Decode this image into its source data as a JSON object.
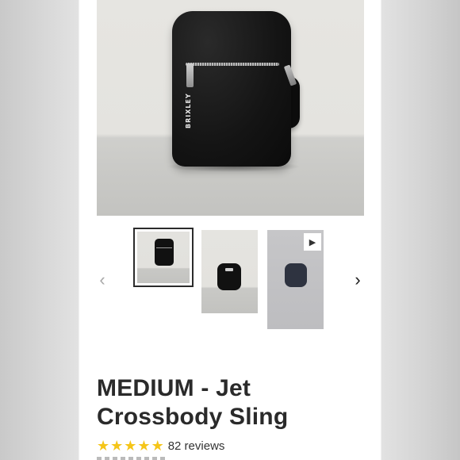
{
  "product": {
    "title": "MEDIUM - Jet Crossbody Sling",
    "hero_brand_text": "BRIXLEY",
    "rating": {
      "stars": 5,
      "star_color": "#f5c518",
      "reviews_text": "82 reviews"
    }
  },
  "carousel": {
    "prev_icon": "chevron-left-icon",
    "next_icon": "chevron-right-icon",
    "prev_glyph": "‹",
    "next_glyph": "›",
    "thumbnails": [
      {
        "kind": "image",
        "selected": true
      },
      {
        "kind": "image",
        "selected": false
      },
      {
        "kind": "video",
        "selected": false,
        "badge_glyph": "▶"
      }
    ]
  },
  "colors": {
    "title": "#2a2a2a",
    "selected_border": "#2b2b2b",
    "inactive_arrow": "#a8a8a8"
  }
}
